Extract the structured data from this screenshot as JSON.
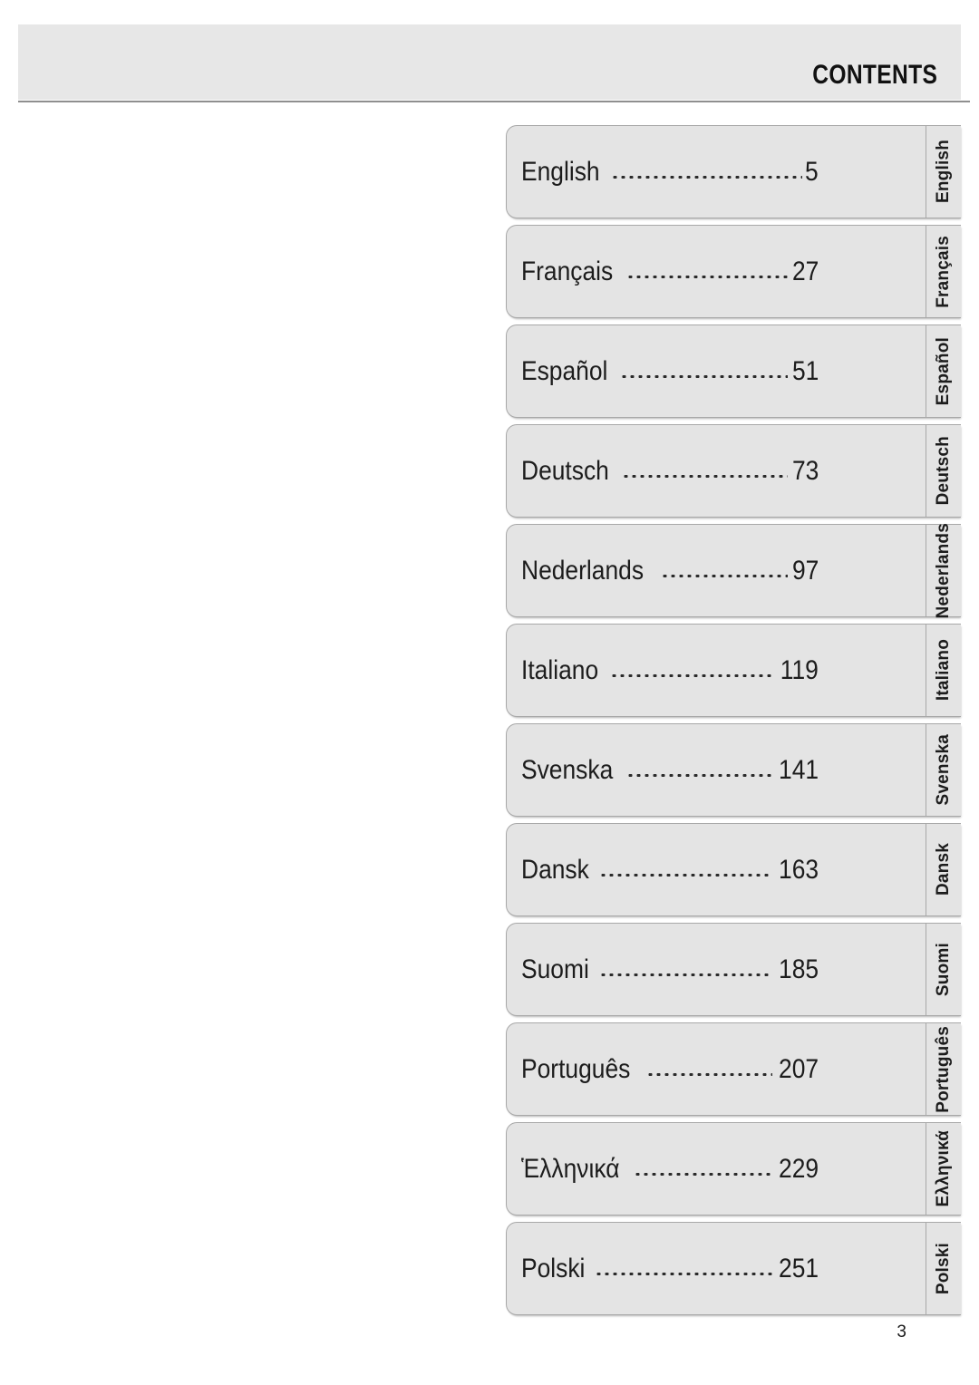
{
  "header": {
    "title": "CONTENTS",
    "bar_color": "#e7e7e7",
    "rule_color": "#8f8f8f"
  },
  "colors": {
    "row_fill": "#e4e4e4",
    "row_border": "#a8a8a8",
    "text": "#1c1c1c",
    "page_background": "#ffffff"
  },
  "contents": {
    "entries": [
      {
        "language": "English",
        "tab": "English",
        "page": "5"
      },
      {
        "language": "Français",
        "tab": "Français",
        "page": "27"
      },
      {
        "language": "Español",
        "tab": "Español",
        "page": "51"
      },
      {
        "language": "Deutsch",
        "tab": "Deutsch",
        "page": "73"
      },
      {
        "language": "Nederlands",
        "tab": "Nederlands",
        "page": "97"
      },
      {
        "language": "Italiano",
        "tab": "Italiano",
        "page": "119"
      },
      {
        "language": "Svenska",
        "tab": "Svenska",
        "page": "141"
      },
      {
        "language": "Dansk",
        "tab": "Dansk",
        "page": "163"
      },
      {
        "language": "Suomi",
        "tab": "Suomi",
        "page": "185"
      },
      {
        "language": "Português",
        "tab": "Português",
        "page": "207"
      },
      {
        "language": "Ἑλληνικά",
        "tab": "Ελληνικά",
        "page": "229"
      },
      {
        "language": "Polski",
        "tab": "Polski",
        "page": "251"
      }
    ]
  },
  "footer": {
    "page_number": "3"
  }
}
